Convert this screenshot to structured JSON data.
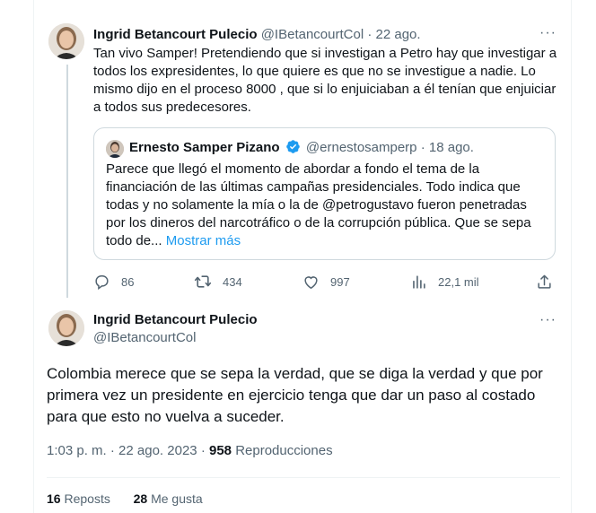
{
  "reply_tweet": {
    "author_name": "Ingrid Betancourt Pulecio",
    "author_handle": "@IBetancourtCol",
    "separator": "·",
    "date": "22 ago.",
    "text": "Tan vivo Samper! Pretendiendo que si investigan a Petro hay que investigar a todos los expresidentes, lo que quiere es que no se investigue a nadie. Lo mismo dijo en el proceso 8000 , que si lo enjuiciaban a él tenían que enjuiciar a todos sus predecesores.",
    "more_icon": "more-icon",
    "quoted": {
      "author_name": "Ernesto Samper Pizano",
      "author_handle": "@ernestosamperp",
      "separator": "·",
      "date": "18 ago.",
      "text": "Parece que llegó el momento de abordar a fondo el tema de la financiación de las últimas campañas presidenciales. Todo indica que todas y no solamente la mía o la de @petrogustavo fueron penetradas por los dineros del narcotráfico o de la corrupción pública. Que se sepa todo de...",
      "show_more": "Mostrar más"
    },
    "actions": {
      "replies": "86",
      "retweets": "434",
      "likes": "997",
      "views": "22,1 mil"
    }
  },
  "main_tweet": {
    "author_name": "Ingrid Betancourt Pulecio",
    "author_handle": "@IBetancourtCol",
    "text": "Colombia merece que se sepa la verdad, que se diga la verdad y que por primera vez un presidente en ejercicio tenga que dar un paso al costado para que esto no vuelva a suceder.",
    "time": "1:03 p. m.",
    "separator": "·",
    "date": "22 ago. 2023",
    "separator2": "·",
    "views_count": "958",
    "views_label": "Reproducciones",
    "reposts_count": "16",
    "reposts_label": "Reposts",
    "likes_count": "28",
    "likes_label": "Me gusta"
  },
  "colors": {
    "text": "#0f1419",
    "secondary": "#536471",
    "link": "#1d9bf0",
    "border": "#cfd9de",
    "verified": "#1d9bf0"
  }
}
